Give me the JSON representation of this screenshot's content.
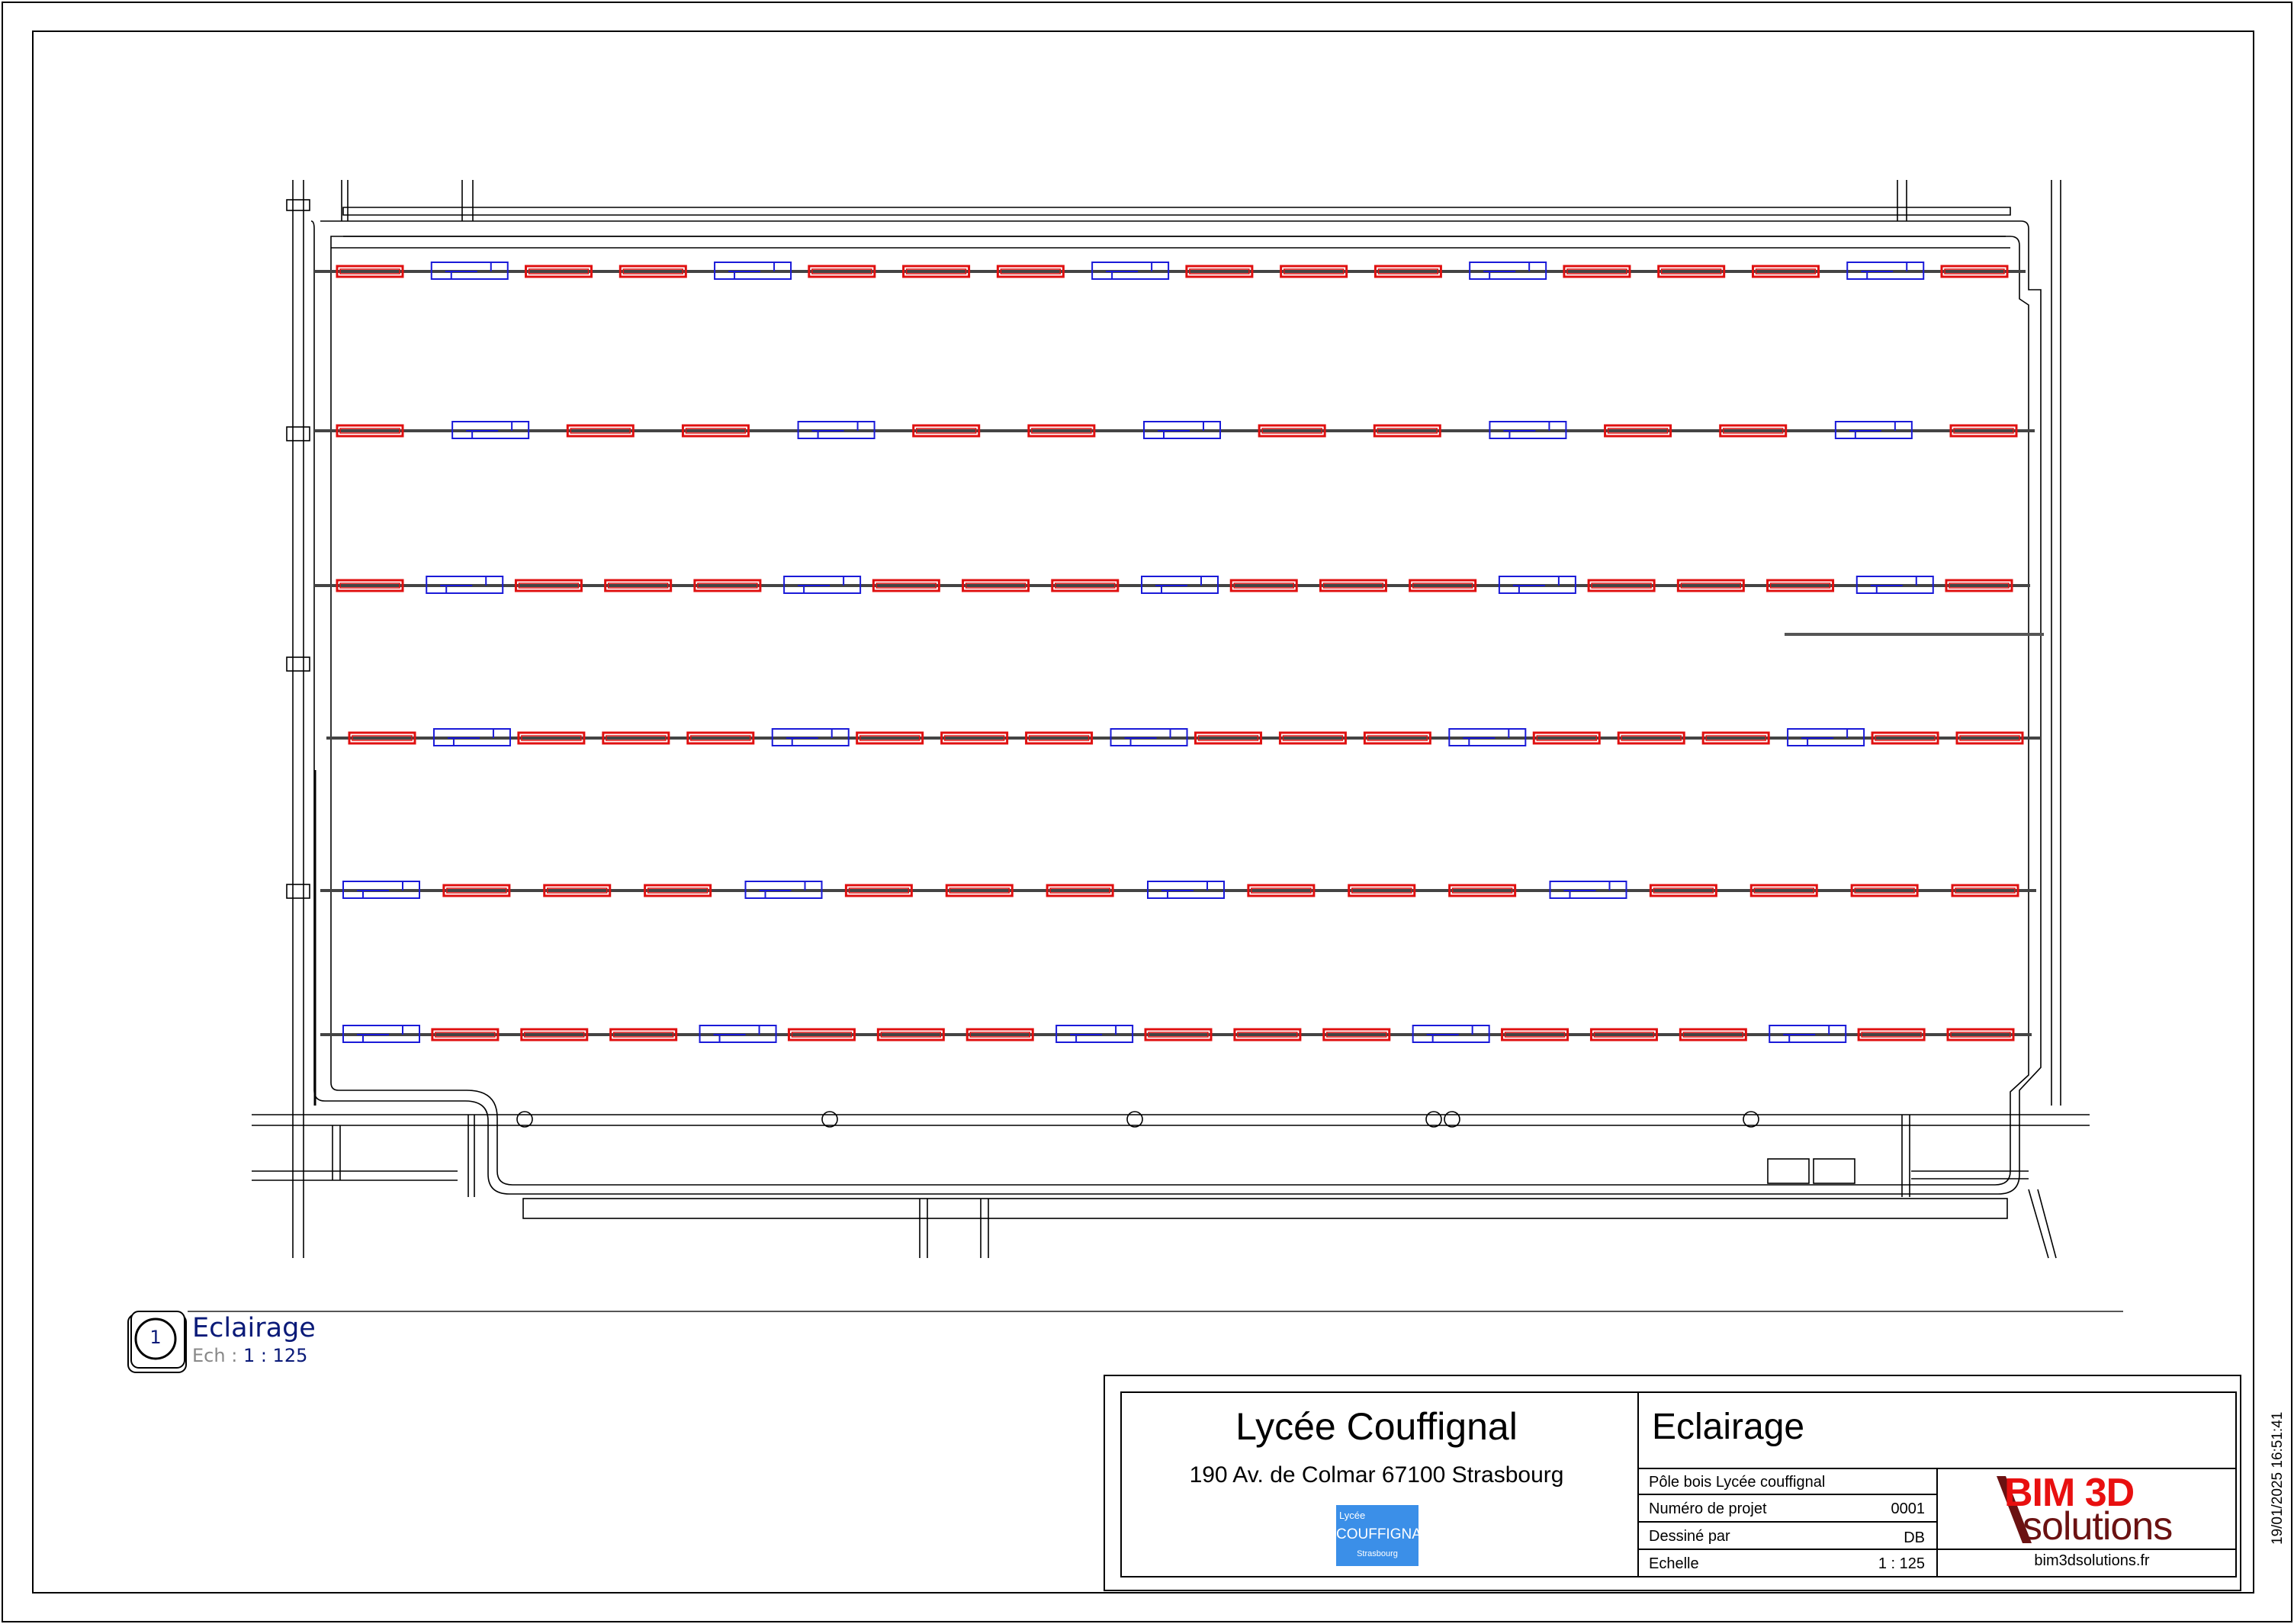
{
  "view": {
    "marker_number": "1",
    "title": "Eclairage",
    "scale_label": "Ech :",
    "scale_value": "1 : 125"
  },
  "title_block": {
    "project_name": "Lycée Couffignal",
    "address": "190 Av. de Colmar 67100 Strasbourg",
    "client_logo": {
      "line1": "Lycée",
      "line2": "COUFFIGNAL",
      "line3": "Strasbourg"
    },
    "sheet_title": "Eclairage",
    "project_description": "Pôle bois Lycée couffignal",
    "rows": [
      {
        "label": "Numéro de projet",
        "value": "0001"
      },
      {
        "label": "Dessiné par",
        "value": "DB"
      },
      {
        "label": "Echelle",
        "value": "1 : 125"
      }
    ],
    "company_logo": {
      "line1": "BIM 3D",
      "line2": "solutions"
    },
    "company_url": "bim3dsolutions.fr",
    "timestamp": "19/01/2025 16:51:41"
  },
  "colors": {
    "luminaire_type_a": "#e01010",
    "luminaire_type_b": "#1a1ad8",
    "view_label": "#0a1a78",
    "client_logo_bg": "#3b8fe8",
    "company_logo_red": "#e81010",
    "company_logo_dark": "#6b1212"
  },
  "drawing": {
    "trunking_rows": [
      {
        "luminaires": [
          "a",
          "b",
          "a",
          "a",
          "b",
          "a",
          "a",
          "a",
          "b",
          "a",
          "a",
          "a",
          "b",
          "a",
          "a",
          "a",
          "b",
          "a"
        ]
      },
      {
        "luminaires": [
          "a",
          "b",
          "a",
          "a",
          "b",
          "a",
          "a",
          "b",
          "a",
          "a",
          "b",
          "a",
          "a",
          "b",
          "a"
        ]
      },
      {
        "luminaires": [
          "a",
          "b",
          "a",
          "a",
          "a",
          "b",
          "a",
          "a",
          "a",
          "b",
          "a",
          "a",
          "a",
          "b",
          "a",
          "a",
          "a",
          "b",
          "a"
        ]
      },
      {
        "luminaires": [
          "a",
          "b",
          "a",
          "a",
          "a",
          "b",
          "a",
          "a",
          "a",
          "b",
          "a",
          "a",
          "a",
          "b",
          "a",
          "a",
          "a",
          "b",
          "a",
          "a"
        ]
      },
      {
        "luminaires": [
          "b",
          "a",
          "a",
          "a",
          "b",
          "a",
          "a",
          "a",
          "b",
          "a",
          "a",
          "a",
          "b",
          "a",
          "a",
          "a",
          "a"
        ]
      },
      {
        "luminaires": [
          "b",
          "a",
          "a",
          "a",
          "b",
          "a",
          "a",
          "a",
          "b",
          "a",
          "a",
          "a",
          "b",
          "a",
          "a",
          "a",
          "b",
          "a",
          "a"
        ]
      }
    ]
  }
}
